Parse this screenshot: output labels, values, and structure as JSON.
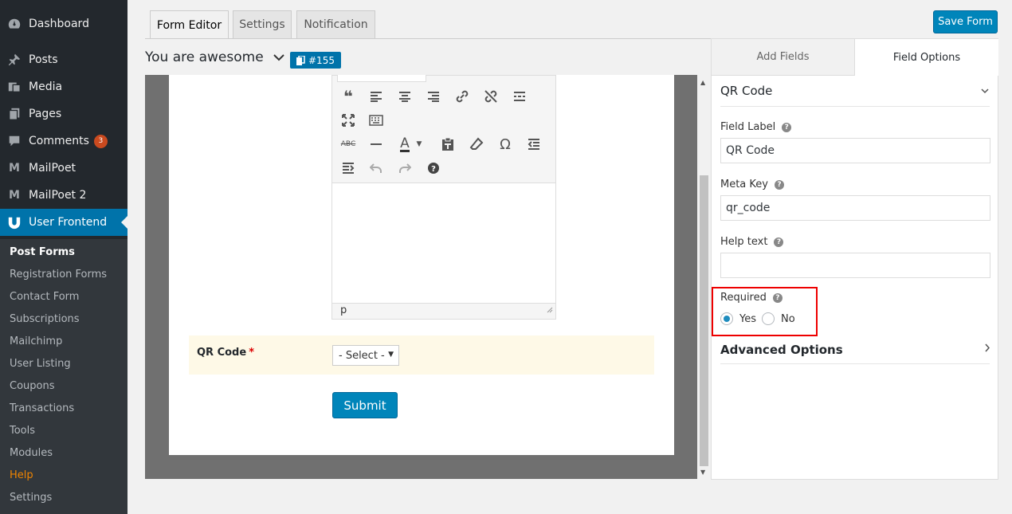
{
  "sidebar": {
    "menu": [
      {
        "label": "Dashboard",
        "icon": "dashboard-icon"
      },
      {
        "label": "Posts",
        "icon": "pin-icon"
      },
      {
        "label": "Media",
        "icon": "media-icon"
      },
      {
        "label": "Pages",
        "icon": "pages-icon"
      },
      {
        "label": "Comments",
        "icon": "comment-icon",
        "badge": "3"
      },
      {
        "label": "MailPoet",
        "icon": "mailpoet-icon"
      },
      {
        "label": "MailPoet 2",
        "icon": "mailpoet-icon"
      },
      {
        "label": "User Frontend",
        "icon": "user-frontend-icon"
      }
    ],
    "submenu": [
      "Post Forms",
      "Registration Forms",
      "Contact Form",
      "Subscriptions",
      "Mailchimp",
      "User Listing",
      "Coupons",
      "Transactions",
      "Tools",
      "Modules",
      "Help",
      "Settings"
    ]
  },
  "tabs": {
    "form_editor": "Form Editor",
    "settings": "Settings",
    "notification": "Notification"
  },
  "form": {
    "title": "You are awesome",
    "id_badge": "#155"
  },
  "editor": {
    "status_path": "p"
  },
  "preview": {
    "field_label": "QR Code",
    "required_mark": "*",
    "select_value": "- Select -",
    "submit_label": "Submit"
  },
  "toolbar": {
    "save_label": "Save Form"
  },
  "panel": {
    "tab_add": "Add Fields",
    "tab_options": "Field Options",
    "section_title": "QR Code",
    "field_label_label": "Field Label",
    "field_label_value": "QR Code",
    "meta_key_label": "Meta Key",
    "meta_key_value": "qr_code",
    "help_text_label": "Help text",
    "help_text_value": "",
    "required_label": "Required",
    "required_yes": "Yes",
    "required_no": "No",
    "advanced_label": "Advanced Options"
  },
  "colors": {
    "sidebar": "#23282d",
    "accent": "#0073aa",
    "button": "#0085ba",
    "highlight_box": "#e00000",
    "qr_row_bg": "#fef9e7"
  }
}
